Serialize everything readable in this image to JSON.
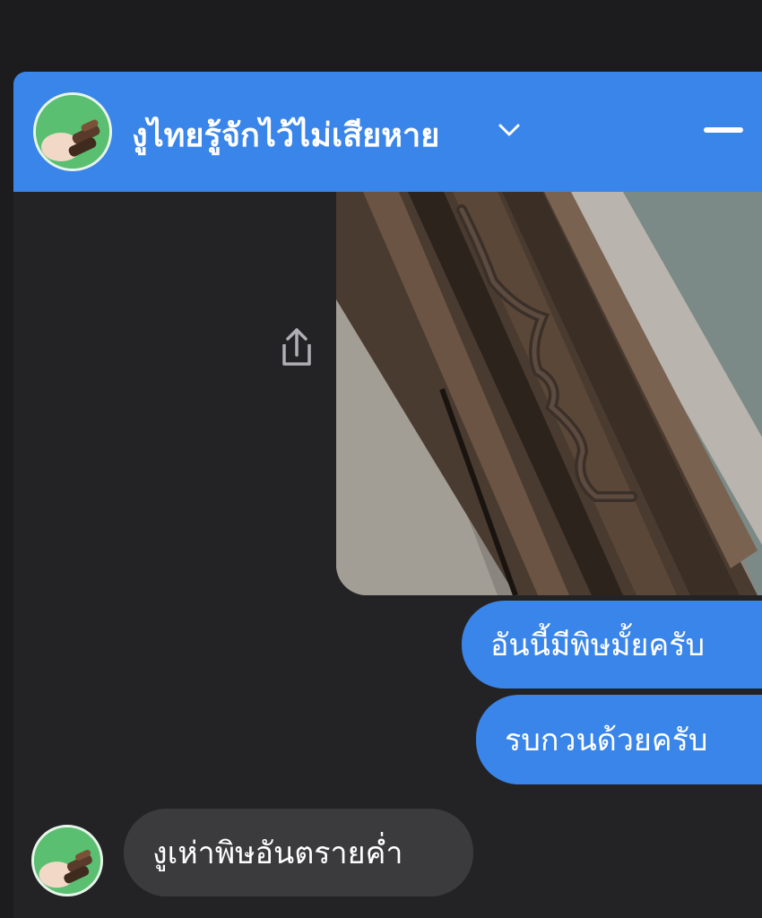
{
  "chat": {
    "title": "งูไทยรู้จักไว้ไม่เสียหาย",
    "header_color": "#3a85ea",
    "icons": {
      "dropdown": "chevron-down-icon",
      "minimize": "minimize-icon",
      "share": "share-icon"
    }
  },
  "messages": {
    "sent": [
      "อันนี้มีพิษมั้ยครับ",
      "รบกวนด้วยครับ"
    ],
    "received": [
      "งูเห่าพิษอันตรายค่ำ"
    ]
  },
  "colors": {
    "sent_bubble": "#3a85ea",
    "received_bubble": "#3b3b3e",
    "background": "#1c1c1e"
  }
}
